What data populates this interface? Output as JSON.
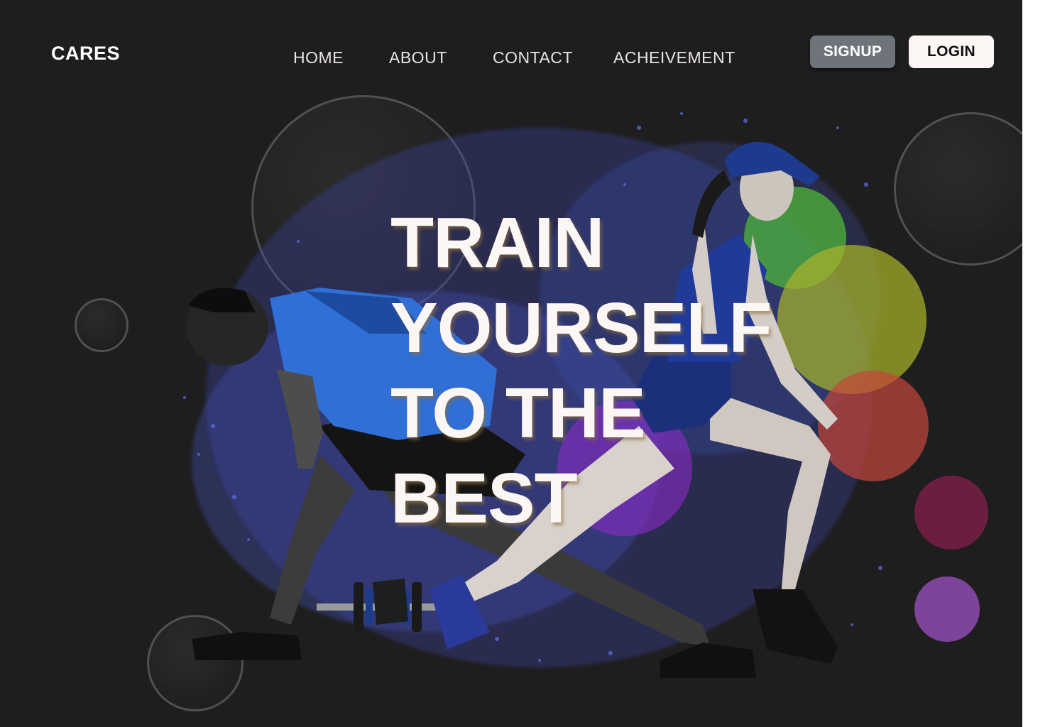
{
  "brand": {
    "logo_text": "CARES"
  },
  "nav": {
    "items": [
      {
        "label": "HOME"
      },
      {
        "label": "ABOUT"
      },
      {
        "label": "CONTACT"
      },
      {
        "label": "ACHEIVEMENT"
      }
    ]
  },
  "auth": {
    "signup_label": "SIGNUP",
    "login_label": "LOGIN"
  },
  "hero": {
    "lines": [
      "TRAIN",
      "YOURSELF",
      "TO THE",
      "BEST"
    ]
  },
  "colors": {
    "background": "#1f1e1f",
    "headline": "#fcf6f5",
    "signup_bg": "#6e747a",
    "login_bg": "#fcf6f5",
    "man_shirt": "#2f6fd6",
    "splatter": "#4a5bd0"
  }
}
